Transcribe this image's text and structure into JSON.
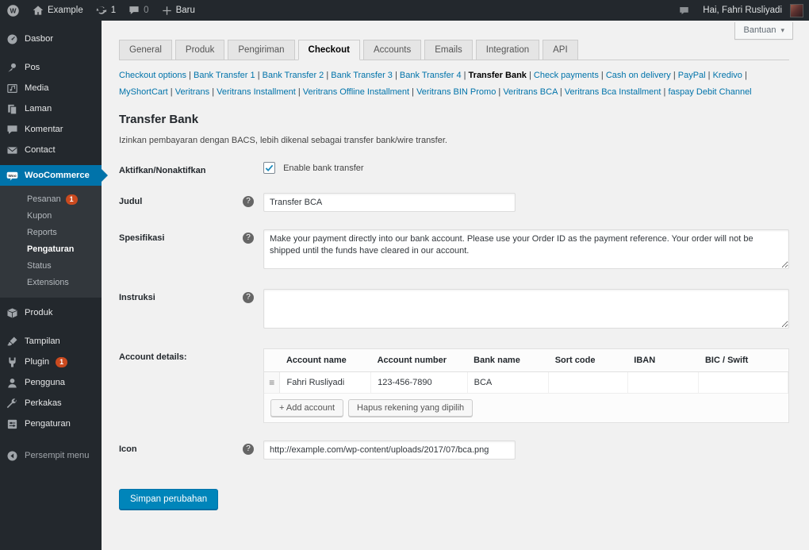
{
  "admin_bar": {
    "site_name": "Example",
    "updates_count": "1",
    "comments_count": "0",
    "new_label": "Baru",
    "greeting": "Hai, Fahri Rusliyadi"
  },
  "help_button": {
    "label": "Bantuan"
  },
  "icons": {
    "chevron_down": "▾",
    "help": "?",
    "drag_handle": "≡"
  },
  "colors": {
    "admin_bar_bg": "#23282d",
    "accent": "#0073aa",
    "primary_button": "#0085ba",
    "badge": "#ca4a1f",
    "content_bg": "#f1f1f1"
  },
  "sidebar": {
    "items": [
      {
        "label": "Dasbor"
      },
      {
        "label": "Pos"
      },
      {
        "label": "Media"
      },
      {
        "label": "Laman"
      },
      {
        "label": "Komentar"
      },
      {
        "label": "Contact"
      },
      {
        "label": "WooCommerce",
        "active": true
      },
      {
        "label": "Produk"
      },
      {
        "label": "Tampilan"
      },
      {
        "label": "Plugin",
        "badge": "1"
      },
      {
        "label": "Pengguna"
      },
      {
        "label": "Perkakas"
      },
      {
        "label": "Pengaturan"
      }
    ],
    "woocommerce_submenu": [
      {
        "label": "Pesanan",
        "badge": "1"
      },
      {
        "label": "Kupon"
      },
      {
        "label": "Reports"
      },
      {
        "label": "Pengaturan",
        "current": true
      },
      {
        "label": "Status"
      },
      {
        "label": "Extensions"
      }
    ],
    "collapse_label": "Persempit menu"
  },
  "tabs": [
    {
      "label": "General"
    },
    {
      "label": "Produk"
    },
    {
      "label": "Pengiriman"
    },
    {
      "label": "Checkout",
      "active": true
    },
    {
      "label": "Accounts"
    },
    {
      "label": "Emails"
    },
    {
      "label": "Integration"
    },
    {
      "label": "API"
    }
  ],
  "subnav": {
    "links": [
      {
        "label": "Checkout options"
      },
      {
        "label": "Bank Transfer 1"
      },
      {
        "label": "Bank Transfer 2"
      },
      {
        "label": "Bank Transfer 3"
      },
      {
        "label": "Bank Transfer 4"
      },
      {
        "label": "Transfer Bank",
        "current": true
      },
      {
        "label": "Check payments"
      },
      {
        "label": "Cash on delivery"
      },
      {
        "label": "PayPal"
      },
      {
        "label": "Kredivo"
      },
      {
        "label": "MyShortCart"
      },
      {
        "label": "Veritrans"
      },
      {
        "label": "Veritrans Installment"
      },
      {
        "label": "Veritrans Offline Installment"
      },
      {
        "label": "Veritrans BIN Promo"
      },
      {
        "label": "Veritrans BCA"
      },
      {
        "label": "Veritrans Bca Installment"
      },
      {
        "label": "faspay Debit Channel"
      }
    ]
  },
  "form": {
    "title": "Transfer Bank",
    "description": "Izinkan pembayaran dengan BACS, lebih dikenal sebagai transfer bank/wire transfer.",
    "enable": {
      "label": "Aktifkan/Nonaktifkan",
      "checkbox_label": "Enable bank transfer",
      "checked": true
    },
    "title_field": {
      "label": "Judul",
      "value": "Transfer BCA"
    },
    "description_field": {
      "label": "Spesifikasi",
      "value": "Make your payment directly into our bank account. Please use your Order ID as the payment reference. Your order will not be shipped until the funds have cleared in our account."
    },
    "instructions_field": {
      "label": "Instruksi",
      "value": ""
    },
    "accounts": {
      "label": "Account details:",
      "columns": {
        "name": "Account name",
        "number": "Account number",
        "bank": "Bank name",
        "sort": "Sort code",
        "iban": "IBAN",
        "bic": "BIC / Swift"
      },
      "rows": [
        {
          "account_name": "Fahri Rusliyadi",
          "account_number": "123-456-7890",
          "bank_name": "BCA",
          "sort_code": "",
          "iban": "",
          "bic": ""
        }
      ],
      "add_button": "+ Add account",
      "delete_button": "Hapus rekening yang dipilih"
    },
    "icon_field": {
      "label": "Icon",
      "value": "http://example.com/wp-content/uploads/2017/07/bca.png"
    },
    "save_button": "Simpan perubahan"
  }
}
